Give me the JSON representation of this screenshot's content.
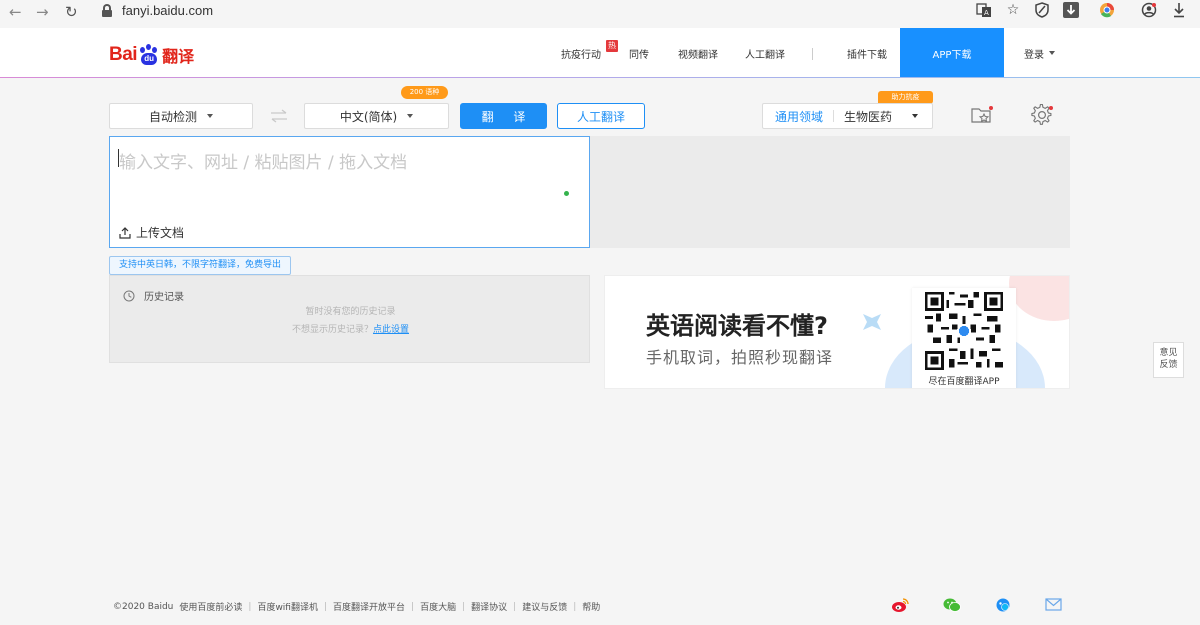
{
  "browser": {
    "url": "fanyi.baidu.com"
  },
  "logo": {
    "bai": "Bai",
    "du": "du",
    "suffix": "翻译"
  },
  "nav": {
    "items": [
      "抗疫行动",
      "同传",
      "视频翻译",
      "人工翻译",
      "插件下载"
    ],
    "hot_badge": "热",
    "app_download": "APP下载",
    "login": "登录"
  },
  "toolbar": {
    "source_lang": "自动检测",
    "target_lang": "中文(简体)",
    "lang_count_badge": "200 语种",
    "translate_button": "翻 译",
    "human_translate_button": "人工翻译",
    "domain_label": "通用领域",
    "domain_value": "生物医药",
    "power_badge": "助力抗疫"
  },
  "input": {
    "placeholder": "输入文字、网址 / 粘贴图片 / 拖入文档",
    "upload_label": "上传文档"
  },
  "hint_tag": "支持中英日韩，不限字符翻译，免费导出",
  "history": {
    "title": "历史记录",
    "empty_text": "暂时没有您的历史记录",
    "prompt_text": "不想显示历史记录？",
    "prompt_link": "点此设置"
  },
  "banner": {
    "headline": "英语阅读看不懂?",
    "subline": "手机取词，拍照秒现翻译",
    "qr_caption": "尽在百度翻译APP"
  },
  "feedback": {
    "line1": "意见",
    "line2": "反馈"
  },
  "footer": {
    "links": [
      "©2020 Baidu",
      "使用百度前必读",
      "百度wifi翻译机",
      "百度翻译开放平台",
      "百度大脑",
      "翻译协议",
      "建议与反馈",
      "帮助"
    ]
  },
  "colors": {
    "brand_blue": "#1e8ff5",
    "app_download_bg": "#1890ff",
    "badge_orange": "#ff9a1a",
    "logo_red": "#e1251b",
    "logo_blue": "#2932e1"
  },
  "icons": [
    "back-icon",
    "forward-icon",
    "reload-icon",
    "lock-icon",
    "translate-ext-icon",
    "star-bookmark-icon",
    "shield-ext-icon",
    "download-ext-icon",
    "chrome-ext-icon",
    "profile-icon",
    "download-arrow-icon",
    "swap-icon",
    "collect-icon",
    "gear-icon",
    "upload-icon",
    "clock-icon",
    "weibo-icon",
    "wechat-icon",
    "qq-icon",
    "mail-icon"
  ]
}
